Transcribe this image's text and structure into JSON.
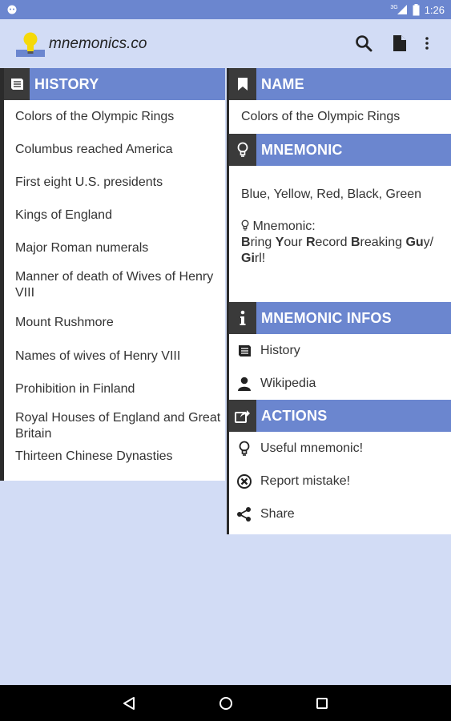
{
  "status_bar": {
    "time": "1:26",
    "network_label": "3G"
  },
  "app": {
    "title": "mnemonics.co"
  },
  "history": {
    "header": "HISTORY",
    "items": [
      "Colors of the Olympic Rings",
      "Columbus reached America",
      "First eight U.S. presidents",
      "Kings of England",
      "Major Roman numerals",
      "Manner of death of Wives of Henry VIII",
      "Mount Rushmore",
      "Names of wives of Henry VIII",
      "Prohibition in Finland",
      "Royal Houses of England and Great Britain",
      "Thirteen Chinese Dynasties"
    ]
  },
  "detail": {
    "name_header": "NAME",
    "name_value": "Colors of the Olympic Rings",
    "mnemonic_header": "MNEMONIC",
    "answer": "Blue, Yellow, Red, Black, Green",
    "mnemonic_label": "Mnemonic:",
    "mnemonic_words": [
      {
        "first": "B",
        "rest": "ring "
      },
      {
        "first": "Y",
        "rest": "our "
      },
      {
        "first": "R",
        "rest": "ecord "
      },
      {
        "first": "B",
        "rest": "reaking "
      },
      {
        "first": "Gu",
        "rest": "y/ "
      },
      {
        "first": "Gi",
        "rest": "rl!"
      }
    ],
    "infos_header": "MNEMONIC INFOS",
    "infos": [
      {
        "label": "History",
        "icon": "book-icon"
      },
      {
        "label": "Wikipedia",
        "icon": "person-icon"
      }
    ],
    "actions_header": "ACTIONS",
    "actions": [
      {
        "label": "Useful mnemonic!",
        "icon": "lightbulb-icon"
      },
      {
        "label": "Report mistake!",
        "icon": "close-circle-icon"
      },
      {
        "label": "Share",
        "icon": "share-icon"
      }
    ]
  },
  "colors": {
    "accent": "#6b86cf",
    "background": "#d2dcf5",
    "header_icon_bg": "#3a3a3a"
  }
}
